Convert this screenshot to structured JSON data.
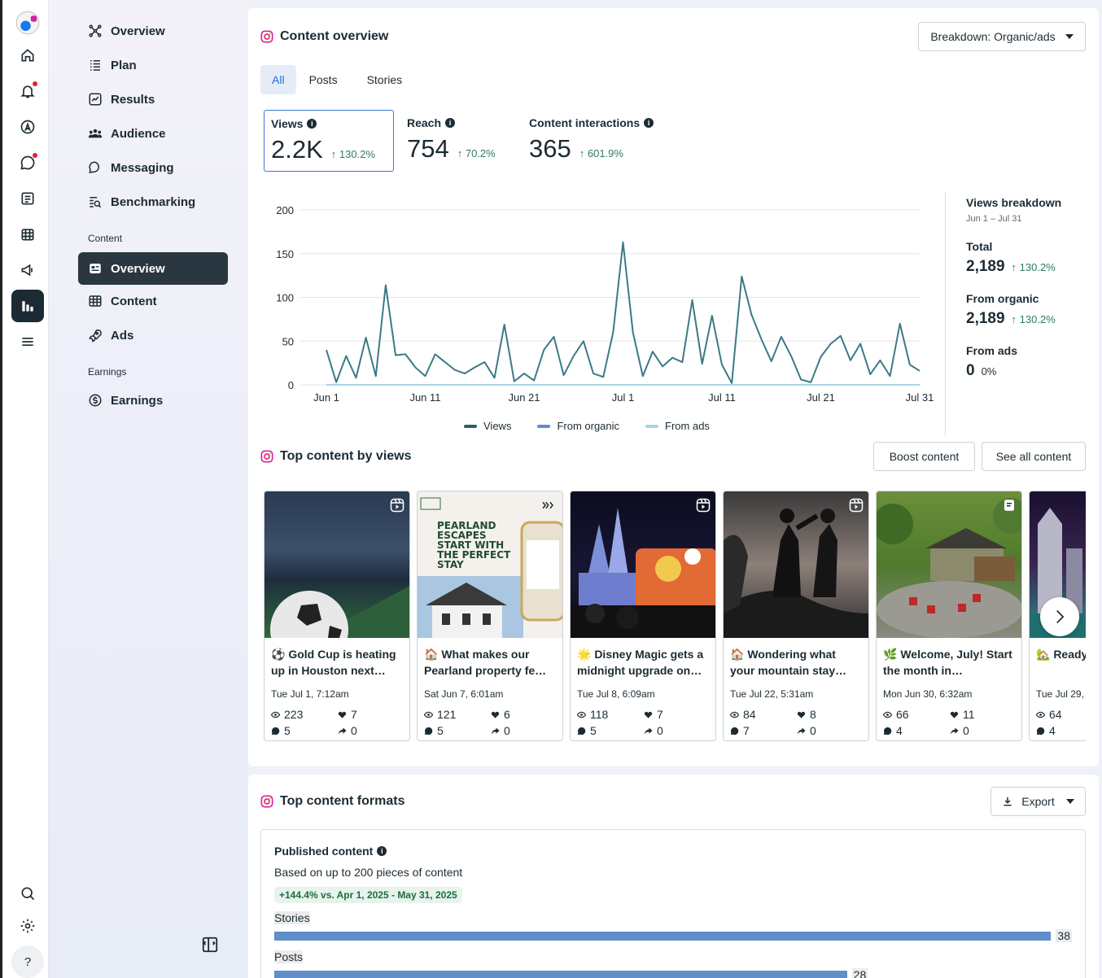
{
  "rail": {
    "icons": [
      "home-icon",
      "bell-icon",
      "compass-icon",
      "chat-icon",
      "pages-icon",
      "calendar-icon",
      "megaphone-icon",
      "insights-icon",
      "menu-icon",
      "search-icon",
      "gear-icon",
      "help-icon"
    ],
    "help_label": "?"
  },
  "nav": {
    "items": [
      {
        "label": "Overview"
      },
      {
        "label": "Plan"
      },
      {
        "label": "Results"
      },
      {
        "label": "Audience"
      },
      {
        "label": "Messaging"
      },
      {
        "label": "Benchmarking"
      }
    ],
    "content_section": "Content",
    "content_items": [
      {
        "label": "Overview"
      },
      {
        "label": "Content"
      },
      {
        "label": "Ads"
      }
    ],
    "earnings_section": "Earnings",
    "earnings_items": [
      {
        "label": "Earnings"
      }
    ]
  },
  "overview": {
    "title": "Content overview",
    "breakdown_label": "Breakdown: Organic/ads",
    "tabs": [
      "All",
      "Posts",
      "Stories"
    ],
    "metrics": [
      {
        "label": "Views",
        "value": "2.2K",
        "change": "130.2%"
      },
      {
        "label": "Reach",
        "value": "754",
        "change": "70.2%"
      },
      {
        "label": "Content interactions",
        "value": "365",
        "change": "601.9%"
      }
    ],
    "legend": [
      "Views",
      "From organic",
      "From ads"
    ],
    "breakdown": {
      "title": "Views breakdown",
      "dates": "Jun 1 – Jul 31",
      "total_label": "Total",
      "total": "2,189",
      "total_change": "130.2%",
      "organic_label": "From organic",
      "organic": "2,189",
      "organic_change": "130.2%",
      "ads_label": "From ads",
      "ads": "0",
      "ads_pct": "0%"
    }
  },
  "chart_data": {
    "type": "line",
    "x_ticks": [
      "Jun 1",
      "Jun 11",
      "Jun 21",
      "Jul 1",
      "Jul 11",
      "Jul 21",
      "Jul 31"
    ],
    "y_ticks": [
      "0",
      "50",
      "100",
      "150",
      "200"
    ],
    "ylim": [
      0,
      200
    ],
    "colors": {
      "views": "#3b7a86",
      "ads": "#a9d3ea"
    },
    "series": [
      {
        "name": "Views",
        "values": [
          40,
          3,
          33,
          8,
          54,
          10,
          114,
          34,
          35,
          20,
          10,
          35,
          26,
          17,
          13,
          20,
          26,
          8,
          69,
          4,
          13,
          5,
          40,
          55,
          11,
          33,
          50,
          13,
          9,
          60,
          163,
          60,
          10,
          38,
          21,
          31,
          26,
          97,
          24,
          79,
          23,
          2,
          124,
          80,
          52,
          27,
          55,
          33,
          6,
          3,
          32,
          47,
          56,
          28,
          47,
          12,
          28,
          10,
          70,
          23,
          16
        ]
      },
      {
        "name": "From ads",
        "values": [
          0,
          0,
          0,
          0,
          0,
          0,
          0,
          0,
          0,
          0,
          0,
          0,
          0,
          0,
          0,
          0,
          0,
          0,
          0,
          0,
          0,
          0,
          0,
          0,
          0,
          0,
          0,
          0,
          0,
          0,
          0,
          0,
          0,
          0,
          0,
          0,
          0,
          0,
          0,
          0,
          0,
          0,
          0,
          0,
          0,
          0,
          0,
          0,
          0,
          0,
          0,
          0,
          0,
          0,
          0,
          0,
          0,
          0,
          0,
          0,
          0
        ]
      }
    ]
  },
  "top_content": {
    "title": "Top content by views",
    "boost_label": "Boost content",
    "see_all_label": "See all content",
    "cards": [
      {
        "caption": "⚽ Gold Cup is heating up in Houston next…",
        "date": "Tue Jul 1, 7:12am",
        "views": "223",
        "likes": "7",
        "comments": "5",
        "shares": "0"
      },
      {
        "caption": "🏠 What makes our Pearland property fe…",
        "date": "Sat Jun 7, 6:01am",
        "views": "121",
        "likes": "6",
        "comments": "5",
        "shares": "0",
        "thumb_title": "PEARLAND ESCAPES START WITH THE PERFECT STAY"
      },
      {
        "caption": "🌟 Disney Magic gets a midnight upgrade on…",
        "date": "Tue Jul 8, 6:09am",
        "views": "118",
        "likes": "7",
        "comments": "5",
        "shares": "0"
      },
      {
        "caption": "🏠 Wondering what your mountain stay…",
        "date": "Tue Jul 22, 5:31am",
        "views": "84",
        "likes": "8",
        "comments": "7",
        "shares": "0"
      },
      {
        "caption": "🌿 Welcome, July! Start the month in…",
        "date": "Mon Jun 30, 6:32am",
        "views": "66",
        "likes": "11",
        "comments": "4",
        "shares": "0"
      },
      {
        "caption": "🏡 Ready Duval De",
        "date": "Tue Jul 29,",
        "views": "64",
        "likes": "",
        "comments": "4",
        "shares": ""
      }
    ]
  },
  "formats": {
    "title": "Top content formats",
    "export_label": "Export",
    "published_title": "Published content",
    "subtitle": "Based on up to 200 pieces of content",
    "badge": "+144.4% vs. Apr 1, 2025 - May 31, 2025",
    "bars": [
      {
        "label": "Stories",
        "value": 38
      },
      {
        "label": "Posts",
        "value": 28
      }
    ]
  }
}
